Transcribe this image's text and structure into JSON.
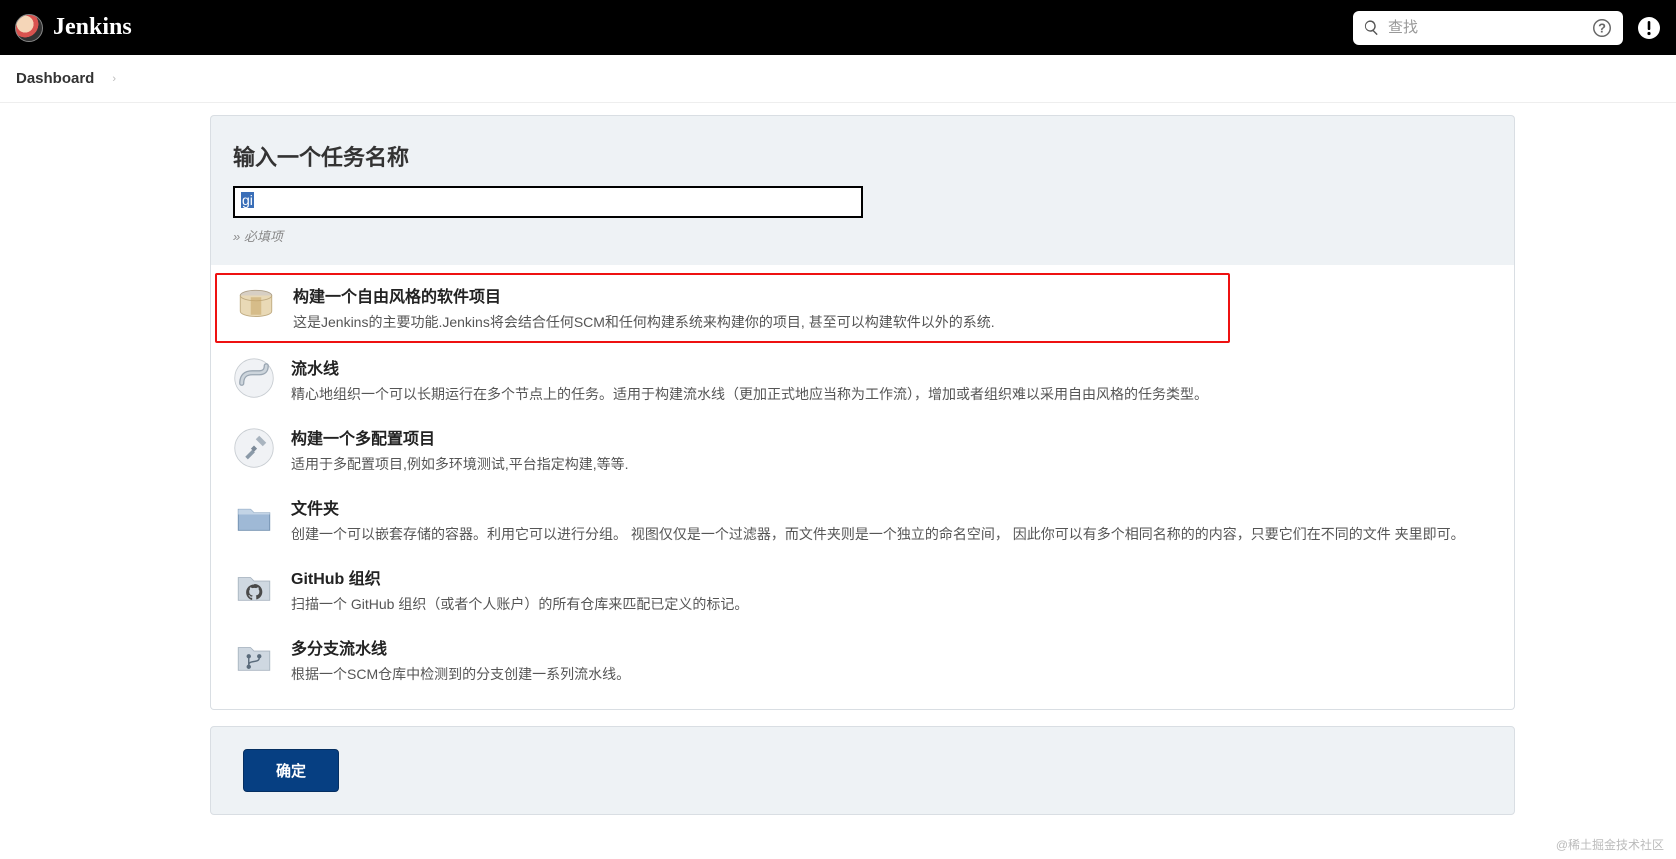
{
  "header": {
    "title": "Jenkins",
    "search_placeholder": "查找"
  },
  "breadcrumb": {
    "dashboard": "Dashboard"
  },
  "form": {
    "heading": "输入一个任务名称",
    "name_value": "gi",
    "required_note": "» 必填项"
  },
  "types": [
    {
      "title": "构建一个自由风格的软件项目",
      "desc": "这是Jenkins的主要功能.Jenkins将会结合任何SCM和任何构建系统来构建你的项目, 甚至可以构建软件以外的系统."
    },
    {
      "title": "流水线",
      "desc": "精心地组织一个可以长期运行在多个节点上的任务。适用于构建流水线（更加正式地应当称为工作流），增加或者组织难以采用自由风格的任务类型。"
    },
    {
      "title": "构建一个多配置项目",
      "desc": "适用于多配置项目,例如多环境测试,平台指定构建,等等."
    },
    {
      "title": "文件夹",
      "desc": "创建一个可以嵌套存储的容器。利用它可以进行分组。 视图仅仅是一个过滤器，而文件夹则是一个独立的命名空间， 因此你可以有多个相同名称的的内容，只要它们在不同的文件 夹里即可。"
    },
    {
      "title": "GitHub 组织",
      "desc": "扫描一个 GitHub 组织（或者个人账户）的所有仓库来匹配已定义的标记。"
    },
    {
      "title": "多分支流水线",
      "desc": "根据一个SCM仓库中检测到的分支创建一系列流水线。"
    }
  ],
  "footer": {
    "ok": "确定"
  },
  "watermark": "@稀土掘金技术社区"
}
